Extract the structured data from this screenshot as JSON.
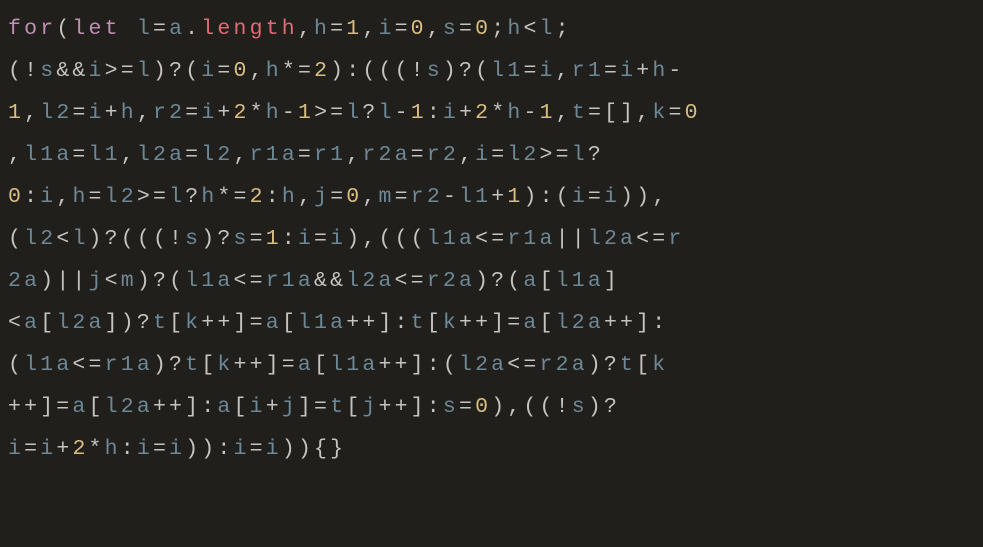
{
  "code_tokens": [
    {
      "t": "for",
      "c": "kw"
    },
    {
      "t": "(",
      "c": "op"
    },
    {
      "t": "let",
      "c": "kw"
    },
    {
      "t": " ",
      "c": "op"
    },
    {
      "t": "l",
      "c": "id"
    },
    {
      "t": "=",
      "c": "op"
    },
    {
      "t": "a",
      "c": "id"
    },
    {
      "t": ".",
      "c": "op"
    },
    {
      "t": "length",
      "c": "prop"
    },
    {
      "t": ",",
      "c": "op"
    },
    {
      "t": "h",
      "c": "id"
    },
    {
      "t": "=",
      "c": "op"
    },
    {
      "t": "1",
      "c": "num"
    },
    {
      "t": ",",
      "c": "op"
    },
    {
      "t": "i",
      "c": "id"
    },
    {
      "t": "=",
      "c": "op"
    },
    {
      "t": "0",
      "c": "num"
    },
    {
      "t": ",",
      "c": "op"
    },
    {
      "t": "s",
      "c": "id"
    },
    {
      "t": "=",
      "c": "op"
    },
    {
      "t": "0",
      "c": "num"
    },
    {
      "t": ";",
      "c": "op"
    },
    {
      "t": "h",
      "c": "id"
    },
    {
      "t": "<",
      "c": "op"
    },
    {
      "t": "l",
      "c": "id"
    },
    {
      "t": ";\n",
      "c": "op"
    },
    {
      "t": "(!",
      "c": "op"
    },
    {
      "t": "s",
      "c": "id"
    },
    {
      "t": "&&",
      "c": "op"
    },
    {
      "t": "i",
      "c": "id"
    },
    {
      "t": ">=",
      "c": "op"
    },
    {
      "t": "l",
      "c": "id"
    },
    {
      "t": ")?(",
      "c": "op"
    },
    {
      "t": "i",
      "c": "id"
    },
    {
      "t": "=",
      "c": "op"
    },
    {
      "t": "0",
      "c": "num"
    },
    {
      "t": ",",
      "c": "op"
    },
    {
      "t": "h",
      "c": "id"
    },
    {
      "t": "*=",
      "c": "op"
    },
    {
      "t": "2",
      "c": "num"
    },
    {
      "t": "):(((!",
      "c": "op"
    },
    {
      "t": "s",
      "c": "id"
    },
    {
      "t": ")?(",
      "c": "op"
    },
    {
      "t": "l1",
      "c": "id"
    },
    {
      "t": "=",
      "c": "op"
    },
    {
      "t": "i",
      "c": "id"
    },
    {
      "t": ",",
      "c": "op"
    },
    {
      "t": "r1",
      "c": "id"
    },
    {
      "t": "=",
      "c": "op"
    },
    {
      "t": "i",
      "c": "id"
    },
    {
      "t": "+",
      "c": "op"
    },
    {
      "t": "h",
      "c": "id"
    },
    {
      "t": "-\n",
      "c": "op"
    },
    {
      "t": "1",
      "c": "num"
    },
    {
      "t": ",",
      "c": "op"
    },
    {
      "t": "l2",
      "c": "id"
    },
    {
      "t": "=",
      "c": "op"
    },
    {
      "t": "i",
      "c": "id"
    },
    {
      "t": "+",
      "c": "op"
    },
    {
      "t": "h",
      "c": "id"
    },
    {
      "t": ",",
      "c": "op"
    },
    {
      "t": "r2",
      "c": "id"
    },
    {
      "t": "=",
      "c": "op"
    },
    {
      "t": "i",
      "c": "id"
    },
    {
      "t": "+",
      "c": "op"
    },
    {
      "t": "2",
      "c": "num"
    },
    {
      "t": "*",
      "c": "op"
    },
    {
      "t": "h",
      "c": "id"
    },
    {
      "t": "-",
      "c": "op"
    },
    {
      "t": "1",
      "c": "num"
    },
    {
      "t": ">=",
      "c": "op"
    },
    {
      "t": "l",
      "c": "id"
    },
    {
      "t": "?",
      "c": "op"
    },
    {
      "t": "l",
      "c": "id"
    },
    {
      "t": "-",
      "c": "op"
    },
    {
      "t": "1",
      "c": "num"
    },
    {
      "t": ":",
      "c": "op"
    },
    {
      "t": "i",
      "c": "id"
    },
    {
      "t": "+",
      "c": "op"
    },
    {
      "t": "2",
      "c": "num"
    },
    {
      "t": "*",
      "c": "op"
    },
    {
      "t": "h",
      "c": "id"
    },
    {
      "t": "-",
      "c": "op"
    },
    {
      "t": "1",
      "c": "num"
    },
    {
      "t": ",",
      "c": "op"
    },
    {
      "t": "t",
      "c": "id"
    },
    {
      "t": "=[],",
      "c": "op"
    },
    {
      "t": "k",
      "c": "id"
    },
    {
      "t": "=",
      "c": "op"
    },
    {
      "t": "0",
      "c": "num"
    },
    {
      "t": "\n",
      "c": "op"
    },
    {
      "t": ",",
      "c": "op"
    },
    {
      "t": "l1a",
      "c": "id"
    },
    {
      "t": "=",
      "c": "op"
    },
    {
      "t": "l1",
      "c": "id"
    },
    {
      "t": ",",
      "c": "op"
    },
    {
      "t": "l2a",
      "c": "id"
    },
    {
      "t": "=",
      "c": "op"
    },
    {
      "t": "l2",
      "c": "id"
    },
    {
      "t": ",",
      "c": "op"
    },
    {
      "t": "r1a",
      "c": "id"
    },
    {
      "t": "=",
      "c": "op"
    },
    {
      "t": "r1",
      "c": "id"
    },
    {
      "t": ",",
      "c": "op"
    },
    {
      "t": "r2a",
      "c": "id"
    },
    {
      "t": "=",
      "c": "op"
    },
    {
      "t": "r2",
      "c": "id"
    },
    {
      "t": ",",
      "c": "op"
    },
    {
      "t": "i",
      "c": "id"
    },
    {
      "t": "=",
      "c": "op"
    },
    {
      "t": "l2",
      "c": "id"
    },
    {
      "t": ">=",
      "c": "op"
    },
    {
      "t": "l",
      "c": "id"
    },
    {
      "t": "?\n",
      "c": "op"
    },
    {
      "t": "0",
      "c": "num"
    },
    {
      "t": ":",
      "c": "op"
    },
    {
      "t": "i",
      "c": "id"
    },
    {
      "t": ",",
      "c": "op"
    },
    {
      "t": "h",
      "c": "id"
    },
    {
      "t": "=",
      "c": "op"
    },
    {
      "t": "l2",
      "c": "id"
    },
    {
      "t": ">=",
      "c": "op"
    },
    {
      "t": "l",
      "c": "id"
    },
    {
      "t": "?",
      "c": "op"
    },
    {
      "t": "h",
      "c": "id"
    },
    {
      "t": "*=",
      "c": "op"
    },
    {
      "t": "2",
      "c": "num"
    },
    {
      "t": ":",
      "c": "op"
    },
    {
      "t": "h",
      "c": "id"
    },
    {
      "t": ",",
      "c": "op"
    },
    {
      "t": "j",
      "c": "id"
    },
    {
      "t": "=",
      "c": "op"
    },
    {
      "t": "0",
      "c": "num"
    },
    {
      "t": ",",
      "c": "op"
    },
    {
      "t": "m",
      "c": "id"
    },
    {
      "t": "=",
      "c": "op"
    },
    {
      "t": "r2",
      "c": "id"
    },
    {
      "t": "-",
      "c": "op"
    },
    {
      "t": "l1",
      "c": "id"
    },
    {
      "t": "+",
      "c": "op"
    },
    {
      "t": "1",
      "c": "num"
    },
    {
      "t": "):(",
      "c": "op"
    },
    {
      "t": "i",
      "c": "id"
    },
    {
      "t": "=",
      "c": "op"
    },
    {
      "t": "i",
      "c": "id"
    },
    {
      "t": ")),\n",
      "c": "op"
    },
    {
      "t": "(",
      "c": "op"
    },
    {
      "t": "l2",
      "c": "id"
    },
    {
      "t": "<",
      "c": "op"
    },
    {
      "t": "l",
      "c": "id"
    },
    {
      "t": ")?(((!",
      "c": "op"
    },
    {
      "t": "s",
      "c": "id"
    },
    {
      "t": ")?",
      "c": "op"
    },
    {
      "t": "s",
      "c": "id"
    },
    {
      "t": "=",
      "c": "op"
    },
    {
      "t": "1",
      "c": "num"
    },
    {
      "t": ":",
      "c": "op"
    },
    {
      "t": "i",
      "c": "id"
    },
    {
      "t": "=",
      "c": "op"
    },
    {
      "t": "i",
      "c": "id"
    },
    {
      "t": "),(((",
      "c": "op"
    },
    {
      "t": "l1a",
      "c": "id"
    },
    {
      "t": "<=",
      "c": "op"
    },
    {
      "t": "r1a",
      "c": "id"
    },
    {
      "t": "||",
      "c": "op"
    },
    {
      "t": "l2a",
      "c": "id"
    },
    {
      "t": "<=",
      "c": "op"
    },
    {
      "t": "r\n",
      "c": "id"
    },
    {
      "t": "2a",
      "c": "id"
    },
    {
      "t": ")||",
      "c": "op"
    },
    {
      "t": "j",
      "c": "id"
    },
    {
      "t": "<",
      "c": "op"
    },
    {
      "t": "m",
      "c": "id"
    },
    {
      "t": ")?(",
      "c": "op"
    },
    {
      "t": "l1a",
      "c": "id"
    },
    {
      "t": "<=",
      "c": "op"
    },
    {
      "t": "r1a",
      "c": "id"
    },
    {
      "t": "&&",
      "c": "op"
    },
    {
      "t": "l2a",
      "c": "id"
    },
    {
      "t": "<=",
      "c": "op"
    },
    {
      "t": "r2a",
      "c": "id"
    },
    {
      "t": ")?(",
      "c": "op"
    },
    {
      "t": "a",
      "c": "id"
    },
    {
      "t": "[",
      "c": "op"
    },
    {
      "t": "l1a",
      "c": "id"
    },
    {
      "t": "]\n",
      "c": "op"
    },
    {
      "t": "<",
      "c": "op"
    },
    {
      "t": "a",
      "c": "id"
    },
    {
      "t": "[",
      "c": "op"
    },
    {
      "t": "l2a",
      "c": "id"
    },
    {
      "t": "])?",
      "c": "op"
    },
    {
      "t": "t",
      "c": "id"
    },
    {
      "t": "[",
      "c": "op"
    },
    {
      "t": "k",
      "c": "id"
    },
    {
      "t": "++]=",
      "c": "op"
    },
    {
      "t": "a",
      "c": "id"
    },
    {
      "t": "[",
      "c": "op"
    },
    {
      "t": "l1a",
      "c": "id"
    },
    {
      "t": "++]:",
      "c": "op"
    },
    {
      "t": "t",
      "c": "id"
    },
    {
      "t": "[",
      "c": "op"
    },
    {
      "t": "k",
      "c": "id"
    },
    {
      "t": "++]=",
      "c": "op"
    },
    {
      "t": "a",
      "c": "id"
    },
    {
      "t": "[",
      "c": "op"
    },
    {
      "t": "l2a",
      "c": "id"
    },
    {
      "t": "++]:\n",
      "c": "op"
    },
    {
      "t": "(",
      "c": "op"
    },
    {
      "t": "l1a",
      "c": "id"
    },
    {
      "t": "<=",
      "c": "op"
    },
    {
      "t": "r1a",
      "c": "id"
    },
    {
      "t": ")?",
      "c": "op"
    },
    {
      "t": "t",
      "c": "id"
    },
    {
      "t": "[",
      "c": "op"
    },
    {
      "t": "k",
      "c": "id"
    },
    {
      "t": "++]=",
      "c": "op"
    },
    {
      "t": "a",
      "c": "id"
    },
    {
      "t": "[",
      "c": "op"
    },
    {
      "t": "l1a",
      "c": "id"
    },
    {
      "t": "++]:(",
      "c": "op"
    },
    {
      "t": "l2a",
      "c": "id"
    },
    {
      "t": "<=",
      "c": "op"
    },
    {
      "t": "r2a",
      "c": "id"
    },
    {
      "t": ")?",
      "c": "op"
    },
    {
      "t": "t",
      "c": "id"
    },
    {
      "t": "[",
      "c": "op"
    },
    {
      "t": "k\n",
      "c": "id"
    },
    {
      "t": "++]=",
      "c": "op"
    },
    {
      "t": "a",
      "c": "id"
    },
    {
      "t": "[",
      "c": "op"
    },
    {
      "t": "l2a",
      "c": "id"
    },
    {
      "t": "++]:",
      "c": "op"
    },
    {
      "t": "a",
      "c": "id"
    },
    {
      "t": "[",
      "c": "op"
    },
    {
      "t": "i",
      "c": "id"
    },
    {
      "t": "+",
      "c": "op"
    },
    {
      "t": "j",
      "c": "id"
    },
    {
      "t": "]=",
      "c": "op"
    },
    {
      "t": "t",
      "c": "id"
    },
    {
      "t": "[",
      "c": "op"
    },
    {
      "t": "j",
      "c": "id"
    },
    {
      "t": "++]:",
      "c": "op"
    },
    {
      "t": "s",
      "c": "id"
    },
    {
      "t": "=",
      "c": "op"
    },
    {
      "t": "0",
      "c": "num"
    },
    {
      "t": "),((!",
      "c": "op"
    },
    {
      "t": "s",
      "c": "id"
    },
    {
      "t": ")?\n",
      "c": "op"
    },
    {
      "t": "i",
      "c": "id"
    },
    {
      "t": "=",
      "c": "op"
    },
    {
      "t": "i",
      "c": "id"
    },
    {
      "t": "+",
      "c": "op"
    },
    {
      "t": "2",
      "c": "num"
    },
    {
      "t": "*",
      "c": "op"
    },
    {
      "t": "h",
      "c": "id"
    },
    {
      "t": ":",
      "c": "op"
    },
    {
      "t": "i",
      "c": "id"
    },
    {
      "t": "=",
      "c": "op"
    },
    {
      "t": "i",
      "c": "id"
    },
    {
      "t": ")):",
      "c": "op"
    },
    {
      "t": "i",
      "c": "id"
    },
    {
      "t": "=",
      "c": "op"
    },
    {
      "t": "i",
      "c": "id"
    },
    {
      "t": ")){}",
      "c": "op"
    }
  ]
}
